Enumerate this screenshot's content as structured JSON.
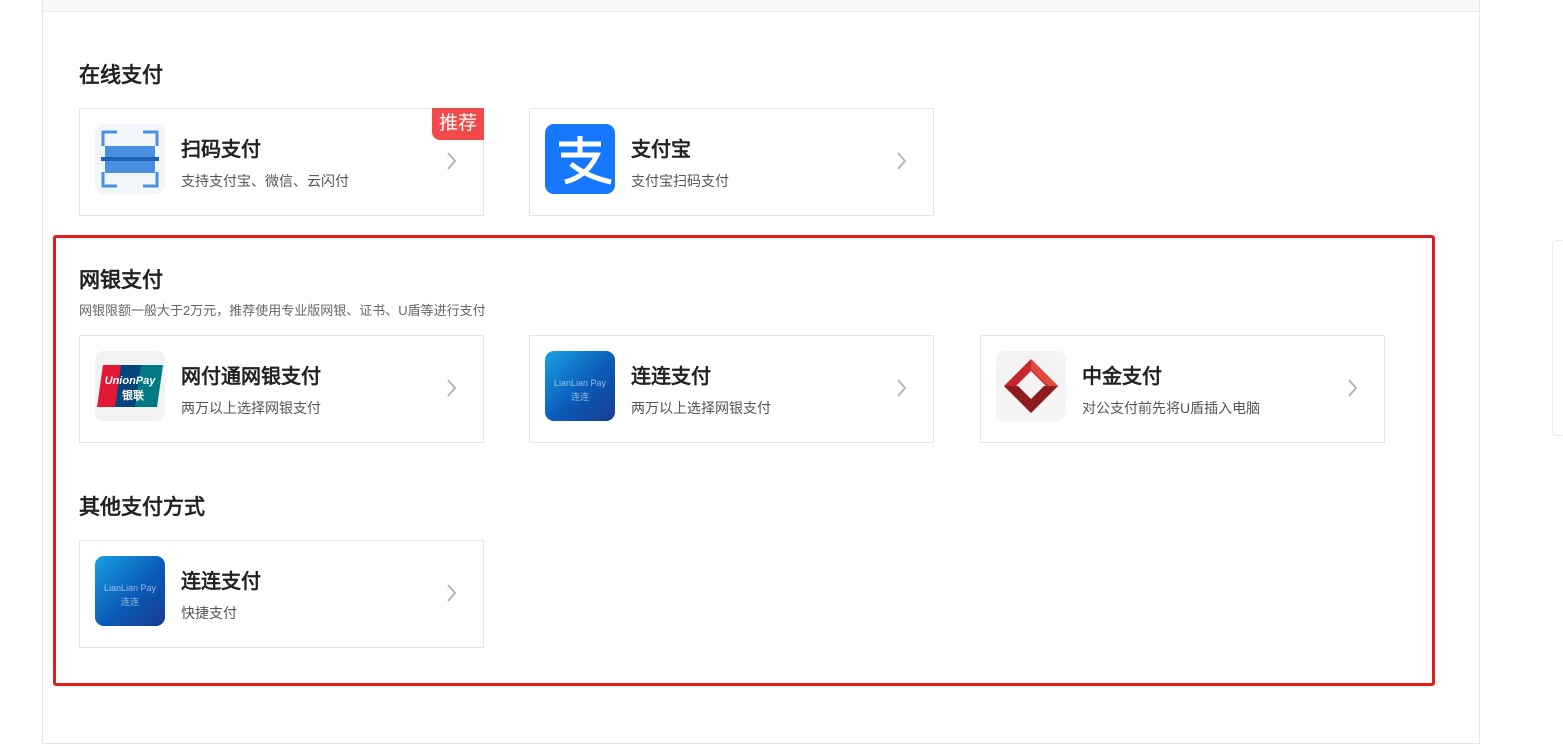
{
  "sections": {
    "online": {
      "title": "在线支付"
    },
    "bank": {
      "title": "网银支付",
      "note": "网银限额一般大于2万元，推荐使用专业版网银、证书、U盾等进行支付"
    },
    "other": {
      "title": "其他支付方式"
    }
  },
  "cards": {
    "scan": {
      "title": "扫码支付",
      "desc": "支持支付宝、微信、云闪付",
      "badge": "推荐",
      "icon": "scan-qr-icon"
    },
    "alipay": {
      "title": "支付宝",
      "desc": "支付宝扫码支付",
      "icon": "alipay-icon"
    },
    "unionpay": {
      "title": "网付通网银支付",
      "desc": "两万以上选择网银支付",
      "icon": "unionpay-icon",
      "logo_text": "UnionPay",
      "logo_cn": "银联"
    },
    "lianlian_bank": {
      "title": "连连支付",
      "desc": "两万以上选择网银支付",
      "icon": "lianlian-pay-icon",
      "logo_text": "LianLian Pay",
      "logo_cn": "连连"
    },
    "cicc": {
      "title": "中金支付",
      "desc": "对公支付前先将U盾插入电脑",
      "icon": "cicc-icon"
    },
    "lianlian_quick": {
      "title": "连连支付",
      "desc": "快捷支付",
      "icon": "lianlian-pay-icon",
      "logo_text": "LianLian Pay",
      "logo_cn": "连连"
    }
  },
  "colors": {
    "highlight": "#e31b1b",
    "badge": "#f24a4a",
    "alipay": "#1677ff",
    "lianlian": "#1576c9",
    "cicc_red": "#c8282b"
  }
}
